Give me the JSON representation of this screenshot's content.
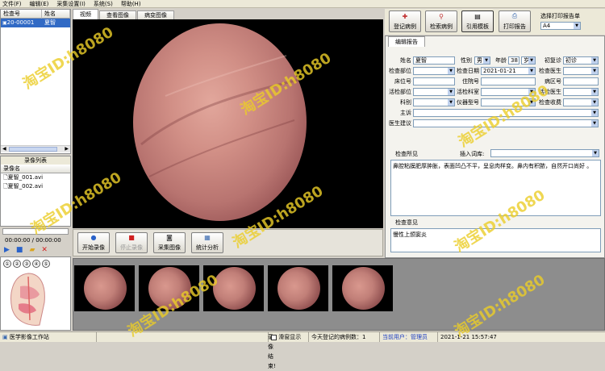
{
  "menu": [
    "文件(F)",
    "编辑(E)",
    "采集设置(I)",
    "系统(S)",
    "帮助(H)"
  ],
  "patient_list": {
    "headers": [
      "检查号",
      "姓名"
    ],
    "rows": [
      {
        "id": "20-00001",
        "name": "夏智"
      }
    ]
  },
  "recording_list": {
    "title": "录像列表",
    "header": "录像名",
    "items": [
      "夏智_001.avi",
      "夏智_002.avi"
    ]
  },
  "player": {
    "time": "00:00:00 / 00:00:00"
  },
  "video_tabs": [
    "视频",
    "查看图像",
    "病变图像"
  ],
  "video_buttons": {
    "start_record": "开始录像",
    "stop_record": "停止录像",
    "capture": "采集图像",
    "statistics": "统计分析"
  },
  "toolbar": {
    "register": "登记病例",
    "search": "检索病例",
    "template": "引用模板",
    "print": "打印报告",
    "print_select_label": "选择打印报告单",
    "print_select_value": "A4"
  },
  "report": {
    "tab": "编辑报告",
    "fields": {
      "name_label": "姓名",
      "name_value": "夏智",
      "sex_label": "性别",
      "sex_value": "男",
      "age_label": "年龄",
      "age_value": "38",
      "age_unit": "岁",
      "visit_label": "初复诊",
      "visit_value": "初诊",
      "part_label": "检查部位",
      "date_label": "检查日期",
      "date_value": "2021-01-21",
      "doctor_label": "检查医生",
      "bed_label": "床位号",
      "hospno_label": "住院号",
      "ward_label": "病区号",
      "biopsy_part_label": "活检部位",
      "biopsy_room_label": "活检科室",
      "biopsy_doctor_label": "活检医生",
      "dept_label": "科别",
      "device_label": "仪器型号",
      "fee_label": "检查收费",
      "complaint_label": "主诉",
      "advice_label": "医生建议"
    },
    "findings_label": "检查所见",
    "insert_label": "插入词库:",
    "findings_text": "鼻腔粘膜肥厚肿胀，表面凹凸不平，呈息肉样变。鼻内有积脓，自然开口尚好 。",
    "opinion_label": "检查意见",
    "opinion_text": "慢性上颌窦炎"
  },
  "status": {
    "app": "医学影像工作站",
    "rec_state": "录像结束!",
    "checkbox": "滑窗显示",
    "today_count": "今天登记的病例数：1",
    "user": "当前用户：管理员",
    "datetime": "2021-1-21  15:57:47"
  },
  "watermark": "淘宝ID:h8080",
  "colors": {
    "accent": "#316ac5",
    "panel": "#f4f3ee",
    "video_bg": "#000000",
    "watermark": "#ebcd28"
  }
}
